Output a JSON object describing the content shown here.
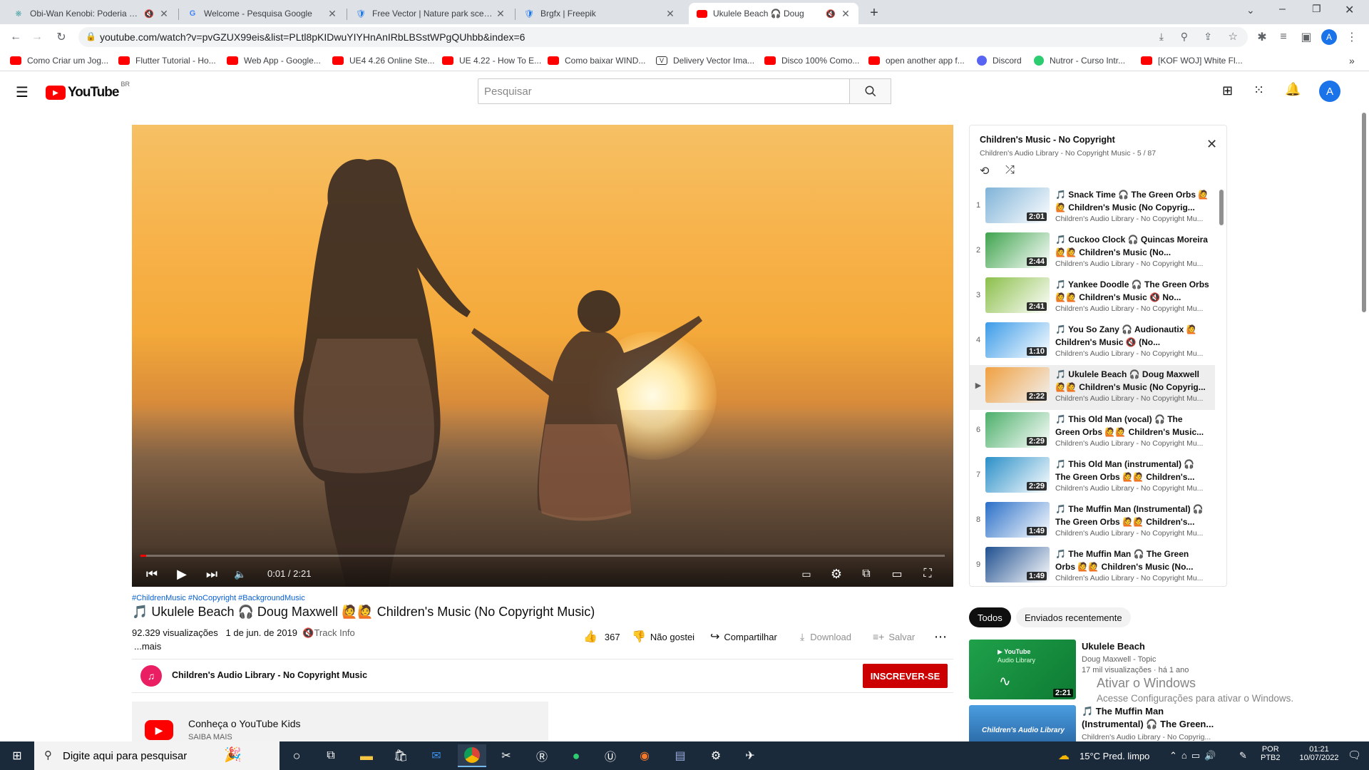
{
  "browser": {
    "tabs": [
      {
        "title": "Obi-Wan Kenobi: Poderia ser",
        "icon": "paramount-icon",
        "muted": true
      },
      {
        "title": "Welcome - Pesquisa Google",
        "icon": "google-icon"
      },
      {
        "title": "Free Vector | Nature park scene b",
        "icon": "freepik-icon"
      },
      {
        "title": "Brgfx | Freepik",
        "icon": "freepik-icon"
      },
      {
        "title": "Ukulele Beach 🎧 Doug",
        "icon": "youtube-icon",
        "muted": true,
        "active": true
      }
    ],
    "url": "youtube.com/watch?v=pvGZUX99eis&list=PLtl8pKIDwuYIYHnAnIRbLBSstWPgQUhbb&index=6",
    "bookmarks": [
      "Como Criar um Jog...",
      "Flutter Tutorial - Ho...",
      "Web App - Google...",
      "UE4 4.26 Online Ste...",
      "UE 4.22 - How To E...",
      "Como baixar WIND...",
      "Delivery Vector Ima...",
      "Disco 100% Como...",
      "open another app f...",
      "Discord",
      "Nutror - Curso Intr...",
      "[KOF WOJ] White Fl..."
    ]
  },
  "youtube": {
    "logo": "YouTube",
    "region": "BR",
    "search_placeholder": "Pesquisar",
    "avatar_letter": "A"
  },
  "player": {
    "time": "0:01 / 2:21",
    "progress": 0.007
  },
  "video": {
    "hashtags": "#ChildrenMusic #NoCopyright #BackgroundMusic",
    "title": "🎵 Ukulele Beach 🎧 Doug Maxwell 🙋🙋 Children's Music (No Copyright Music)",
    "views": "92.329 visualizações",
    "date": "1 de jun. de 2019",
    "track_info": "🔇Track Info",
    "more": "...mais",
    "likes": "367",
    "dislike": "Não gostei",
    "share": "Compartilhar",
    "download": "Download",
    "save": "Salvar",
    "channel": "Children's Audio Library - No Copyright Music",
    "subscribe": "INSCREVER-SE",
    "kids_title": "Conheça o YouTube Kids",
    "kids_link": "SAIBA MAIS"
  },
  "playlist": {
    "title": "Children's Music - No Copyright",
    "subtitle": "Children's Audio Library - No Copyright Music - 5 / 87",
    "items": [
      {
        "index": "1",
        "title": "🎵 Snack Time 🎧 The Green Orbs 🙋🙋 Children's Music (No Copyrig...",
        "channel": "Children's Audio Library - No Copyright Mu...",
        "duration": "2:01",
        "color": "#7fb3d8"
      },
      {
        "index": "2",
        "title": "🎵 Cuckoo Clock 🎧 Quincas Moreira 🙋🙋 Children's Music (No...",
        "channel": "Children's Audio Library - No Copyright Mu...",
        "duration": "2:44",
        "color": "#3fa34d"
      },
      {
        "index": "3",
        "title": "🎵 Yankee Doodle 🎧 The Green Orbs 🙋🙋 Children's Music 🔇 No...",
        "channel": "Children's Audio Library - No Copyright Mu...",
        "duration": "2:41",
        "color": "#8bbf4a"
      },
      {
        "index": "4",
        "title": "🎵 You So Zany 🎧 Audionautix 🙋 Children's Music 🔇 (No...",
        "channel": "Children's Audio Library - No Copyright Mu...",
        "duration": "1:10",
        "color": "#3b9be8"
      },
      {
        "index": "▶",
        "title": "🎵 Ukulele Beach 🎧 Doug Maxwell 🙋🙋 Children's Music (No Copyrig...",
        "channel": "Children's Audio Library - No Copyright Mu...",
        "duration": "2:22",
        "color": "#f0a040",
        "current": true
      },
      {
        "index": "6",
        "title": "🎵 This Old Man (vocal) 🎧 The Green Orbs 🙋🙋 Children's Music...",
        "channel": "Children's Audio Library - No Copyright Mu...",
        "duration": "2:29",
        "color": "#4caf6a"
      },
      {
        "index": "7",
        "title": "🎵 This Old Man (instrumental) 🎧 The Green Orbs 🙋🙋 Children's...",
        "channel": "Children's Audio Library - No Copyright Mu...",
        "duration": "2:29",
        "color": "#2a8fc8"
      },
      {
        "index": "8",
        "title": "🎵 The Muffin Man (Instrumental) 🎧 The Green Orbs 🙋🙋 Children's...",
        "channel": "Children's Audio Library - No Copyright Mu...",
        "duration": "1:49",
        "color": "#2a6fc8"
      },
      {
        "index": "9",
        "title": "🎵 The Muffin Man 🎧 The Green Orbs 🙋🙋 Children's Music (No...",
        "channel": "Children's Audio Library - No Copyright Mu...",
        "duration": "1:49",
        "color": "#1f4f8f"
      }
    ]
  },
  "chips": [
    "Todos",
    "Enviados recentemente"
  ],
  "related": [
    {
      "title": "Ukulele Beach",
      "channel": "Doug Maxwell - Topic",
      "meta": "17 mil visualizações · há 1 ano",
      "duration": "2:21",
      "thumb_text": "Audio Library"
    },
    {
      "title": "🎵 The Muffin Man (Instrumental) 🎧 The Green...",
      "channel": "Children's Audio Library - No Copyrig...",
      "thumb_text": "Children's Audio Library"
    }
  ],
  "watermark": {
    "line1": "Ativar o Windows",
    "line2": "Acesse Configurações para ativar o Windows."
  },
  "taskbar": {
    "search_placeholder": "Digite aqui para pesquisar",
    "weather": "15°C  Pred. limpo",
    "lang": "POR",
    "layout": "PTB2",
    "time": "01:21",
    "date": "10/07/2022"
  }
}
